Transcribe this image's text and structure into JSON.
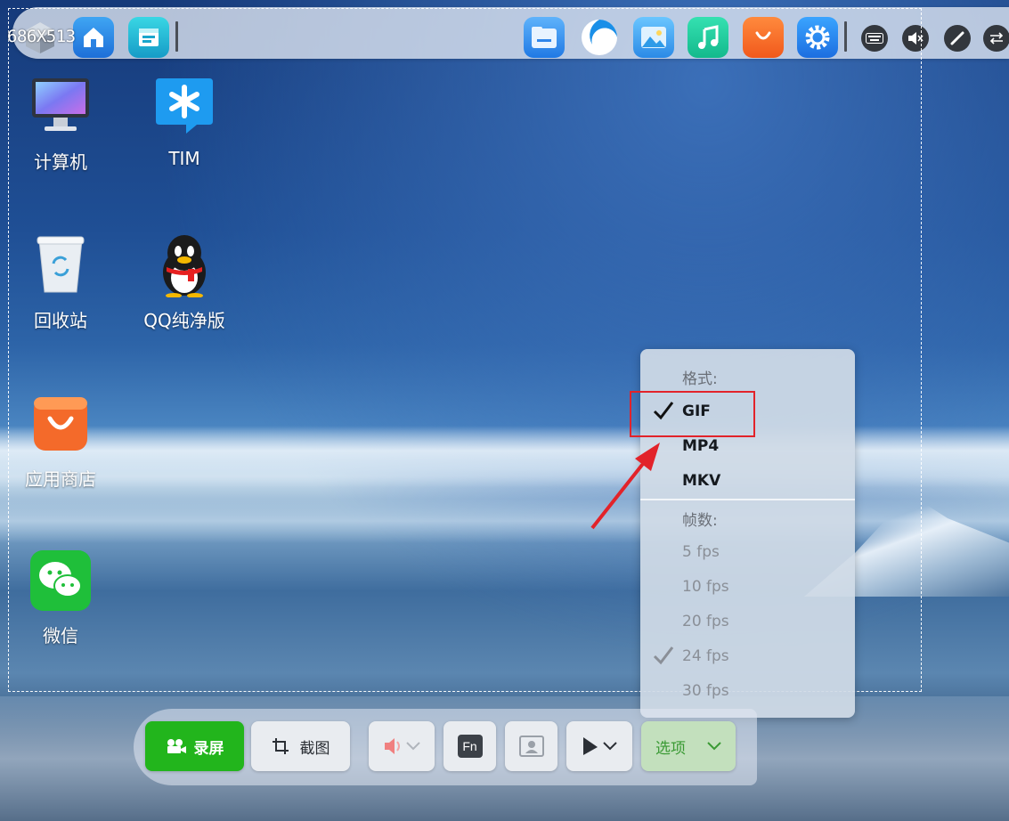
{
  "selection": {
    "dimension_label": "686X513"
  },
  "desktop": {
    "icons": [
      {
        "label": "计算机"
      },
      {
        "label": "TIM"
      },
      {
        "label": "回收站"
      },
      {
        "label": "QQ纯净版"
      },
      {
        "label": "应用商店"
      },
      {
        "label": "微信"
      }
    ]
  },
  "format_menu": {
    "format_header": "格式:",
    "formats": [
      "GIF",
      "MP4",
      "MKV"
    ],
    "selected_format": "GIF",
    "fps_header": "帧数:",
    "fps_options": [
      "5 fps",
      "10 fps",
      "20 fps",
      "24 fps",
      "30 fps"
    ],
    "selected_fps": "24 fps"
  },
  "toolbar": {
    "record_label": "录屏",
    "screenshot_label": "截图",
    "fn_label": "Fn",
    "options_label": "选项"
  },
  "colors": {
    "accent_green": "#22b51c",
    "highlight_red": "#e2232a"
  }
}
